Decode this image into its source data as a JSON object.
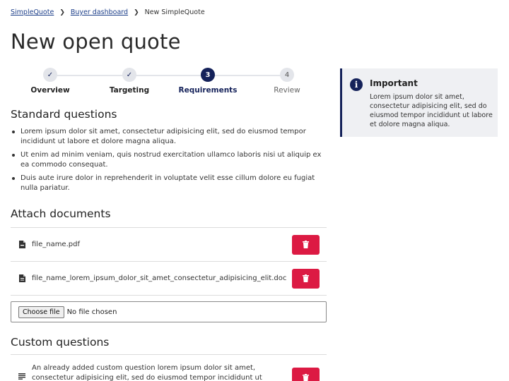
{
  "breadcrumb": {
    "items": [
      "SimpleQuote",
      "Buyer dashboard"
    ],
    "current": "New SimpleQuote"
  },
  "page_title": "New open quote",
  "stepper": {
    "steps": [
      {
        "label": "Overview",
        "state": "done",
        "marker": "✓"
      },
      {
        "label": "Targeting",
        "state": "done",
        "marker": "✓"
      },
      {
        "label": "Requirements",
        "state": "active",
        "marker": "3"
      },
      {
        "label": "Review",
        "state": "todo",
        "marker": "4"
      }
    ]
  },
  "standard_questions": {
    "heading": "Standard questions",
    "items": [
      "Lorem ipsum dolor sit amet, consectetur adipisicing elit, sed do eiusmod tempor incididunt ut labore et dolore magna aliqua.",
      "Ut enim ad minim veniam, quis nostrud exercitation ullamco laboris nisi ut aliquip ex ea commodo consequat.",
      "Duis aute irure dolor in reprehenderit in voluptate velit esse cillum dolore eu fugiat nulla pariatur."
    ]
  },
  "attach_documents": {
    "heading": "Attach documents",
    "files": [
      {
        "name": "file_name.pdf",
        "icon": "pdf-file-icon"
      },
      {
        "name": "file_name_lorem_ipsum_dolor_sit_amet_consectetur_adipisicing_elit.doc",
        "icon": "document-file-icon"
      }
    ],
    "choose_file_label": "Choose file",
    "no_file_text": "No file chosen"
  },
  "custom_questions": {
    "heading": "Custom questions",
    "items": [
      "An already added custom question lorem ipsum dolor sit amet, consectetur adipisicing elit, sed do eiusmod tempor incididunt ut labore et dolore"
    ]
  },
  "notice": {
    "title": "Important",
    "text": "Lorem ipsum dolor sit amet, consectetur adipisicing elit, sed do eiusmod tempor incididunt ut labore et dolore magna aliqua."
  },
  "colors": {
    "primary": "#15225a",
    "danger": "#dc1a43",
    "link": "#1d3f8a",
    "notice_bg": "#eff0f3"
  }
}
